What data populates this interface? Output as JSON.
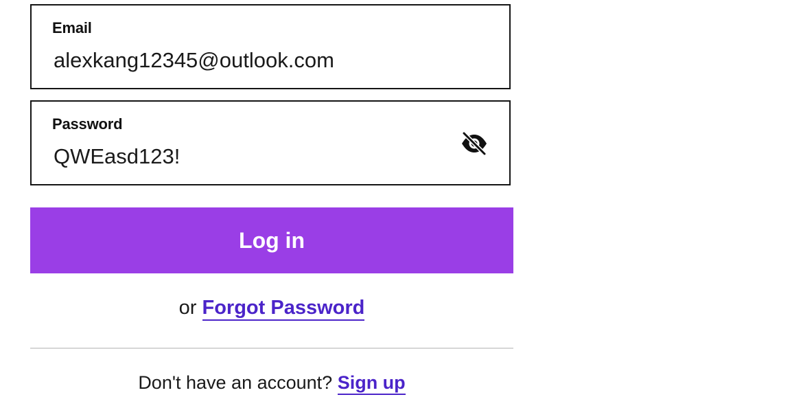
{
  "email": {
    "label": "Email",
    "value": "alexkang12345@outlook.com"
  },
  "password": {
    "label": "Password",
    "value": "QWEasd123!",
    "toggle_icon": "eye-slash-icon"
  },
  "login": {
    "label": "Log in",
    "color": "#9a3ee6"
  },
  "forgot": {
    "prefix": "or",
    "link_label": "Forgot Password"
  },
  "signup": {
    "prompt": "Don't have an account?",
    "link_label": "Sign up"
  },
  "colors": {
    "link": "#4b24c9",
    "border": "#141414",
    "divider": "#d6d6d6"
  }
}
